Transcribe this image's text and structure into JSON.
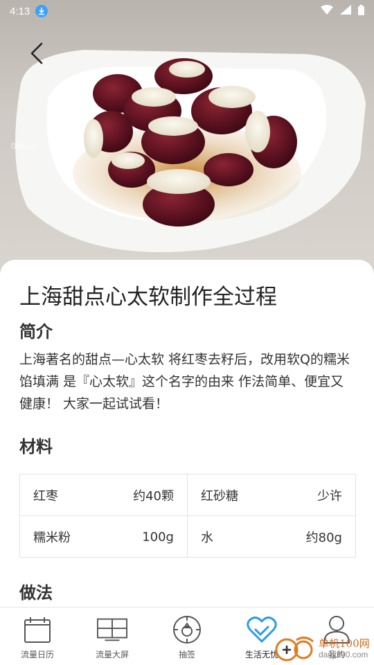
{
  "status_bar": {
    "time": "4:13"
  },
  "hero": {
    "watermark": "0db240"
  },
  "recipe": {
    "title": "上海甜点心太软制作全过程",
    "intro_heading": "简介",
    "intro_text": "上海著名的甜点—心太软 将红枣去籽后，改用软Q的糯米馅填满 是『心太软』这个名字的由来 作法简单、便宜又健康！ 大家一起试试看！",
    "materials_heading": "材料",
    "materials": [
      {
        "name": "红枣",
        "amount": "约40颗"
      },
      {
        "name": "红砂糖",
        "amount": "少许"
      },
      {
        "name": "糯米粉",
        "amount": "100g"
      },
      {
        "name": "水",
        "amount": "约80g"
      }
    ],
    "method_heading": "做法"
  },
  "bottom_nav": {
    "items": [
      {
        "label": "流量日历",
        "icon": "calendar-icon"
      },
      {
        "label": "流量大屏",
        "icon": "grid-screen-icon"
      },
      {
        "label": "抽签",
        "icon": "lottery-icon"
      },
      {
        "label": "生活无忧",
        "icon": "heart-icon",
        "active": true
      },
      {
        "label": "我的",
        "icon": "person-icon"
      }
    ]
  },
  "site_watermark": {
    "name": "单机100网",
    "url": "danji100.com"
  },
  "colors": {
    "accent": "#2a9be8",
    "text": "#222222",
    "border": "#e2e2e2"
  }
}
